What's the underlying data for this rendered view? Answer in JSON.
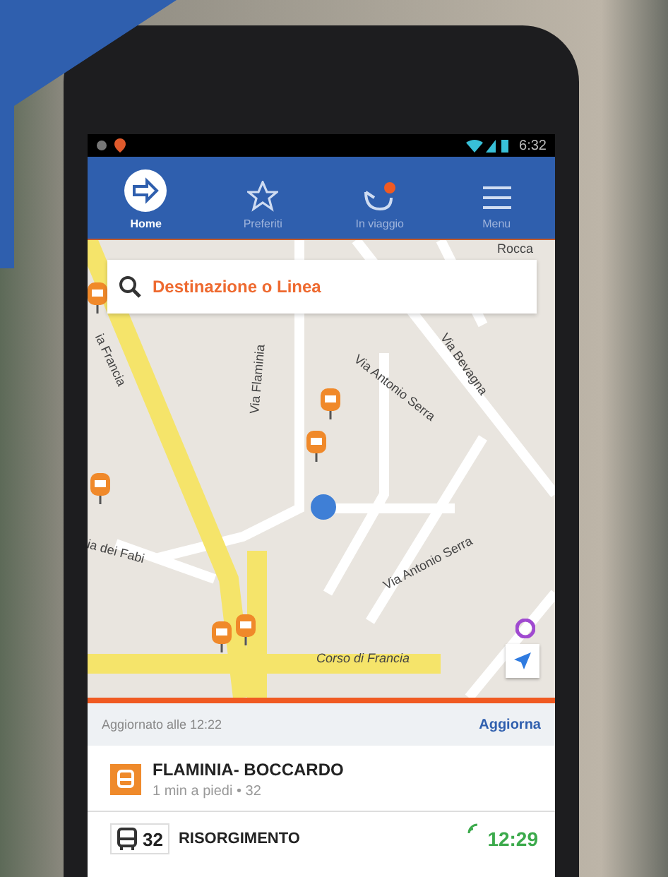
{
  "status_bar": {
    "time": "6:32"
  },
  "tabs": [
    {
      "label": "Home",
      "kind": "arrow",
      "selected": true
    },
    {
      "label": "Preferiti",
      "kind": "star",
      "selected": false
    },
    {
      "label": "In viaggio",
      "kind": "trip",
      "selected": false
    },
    {
      "label": "Menu",
      "kind": "menu",
      "selected": false
    }
  ],
  "search": {
    "placeholder": "Destinazione o Linea"
  },
  "map": {
    "streets": [
      {
        "name": "ia Francia"
      },
      {
        "name": "Via Flaminia"
      },
      {
        "name": "Via Bevagna"
      },
      {
        "name": "Via Antonio Serra"
      },
      {
        "name": "Rocca"
      },
      {
        "name": "ia dei Fabi"
      },
      {
        "name": "Via Antonio Serra"
      },
      {
        "name": "Corso di Francia"
      }
    ]
  },
  "list": {
    "updated": "Aggiornato alle 12:22",
    "refresh": "Aggiorna",
    "stop": {
      "name": "FLAMINIA- BOCCARDO",
      "detail": "1 min a piedi • 32"
    },
    "departures": [
      {
        "line": "32",
        "destination": "RISORGIMENTO",
        "time": "12:29",
        "realtime": true
      }
    ]
  }
}
